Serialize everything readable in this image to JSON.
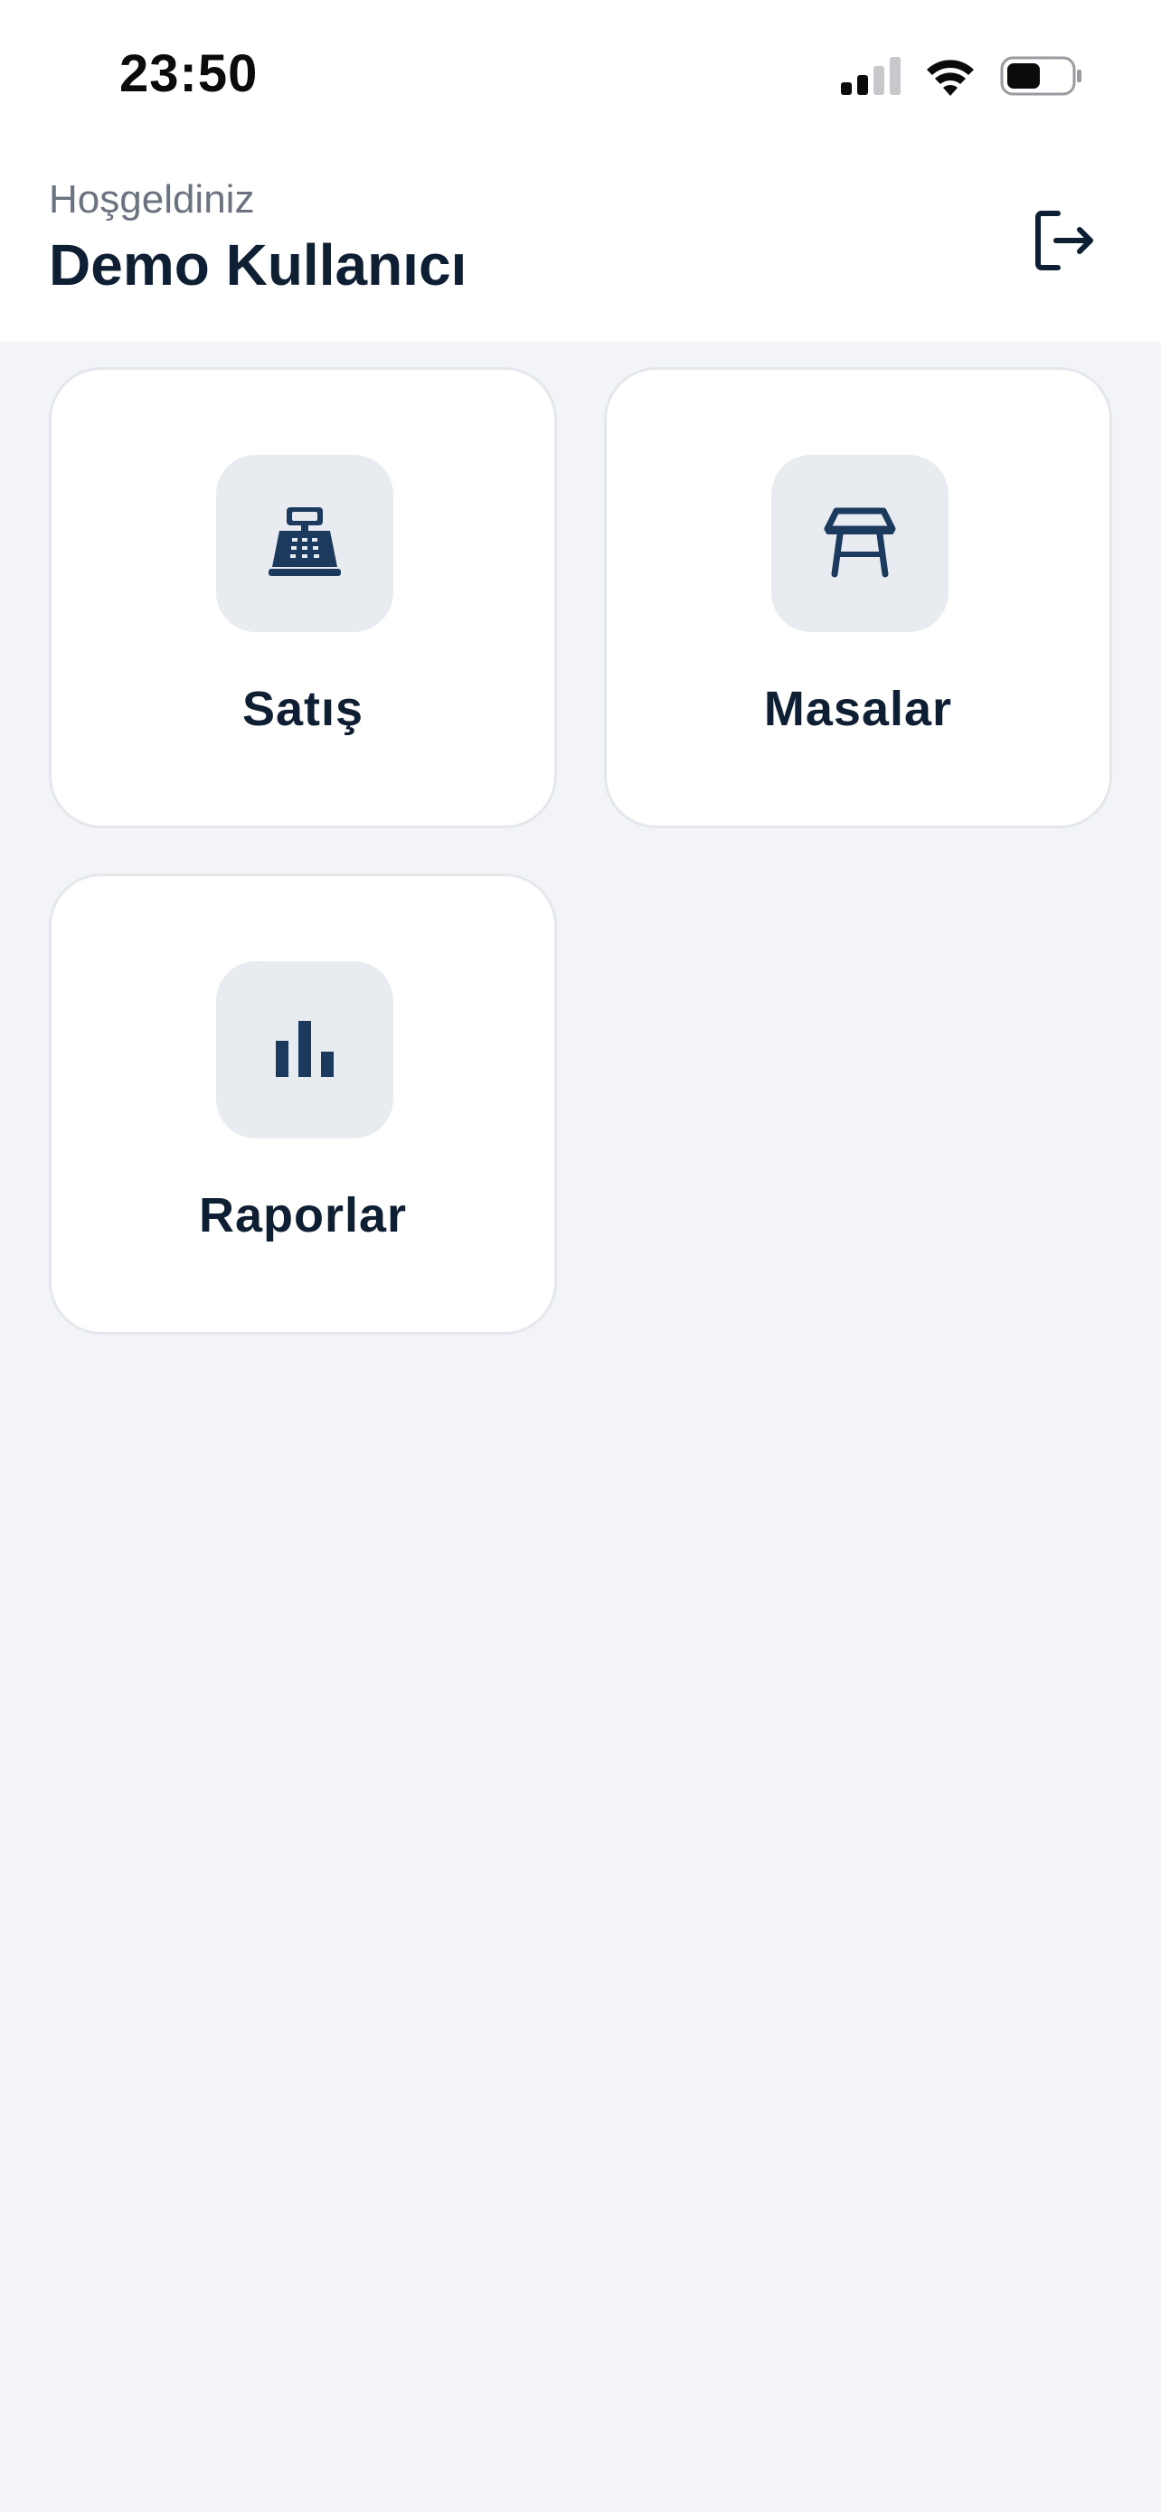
{
  "status_bar": {
    "time": "23:50",
    "icons": [
      "cellular-signal-icon",
      "wifi-icon",
      "battery-icon"
    ]
  },
  "header": {
    "greeting": "Hoşgeldiniz",
    "user_name": "Demo Kullanıcı",
    "logout_icon": "logout-icon"
  },
  "menu": {
    "items": [
      {
        "label": "Satış",
        "icon": "cash-register-icon"
      },
      {
        "label": "Masalar",
        "icon": "table-icon"
      },
      {
        "label": "Raporlar",
        "icon": "bar-chart-icon"
      }
    ]
  },
  "colors": {
    "background": "#f3f4f8",
    "card": "#ffffff",
    "icon_box": "#e8ebef",
    "icon": "#1c3a5e",
    "text_primary": "#0f1f33",
    "text_secondary": "#6b7280"
  }
}
